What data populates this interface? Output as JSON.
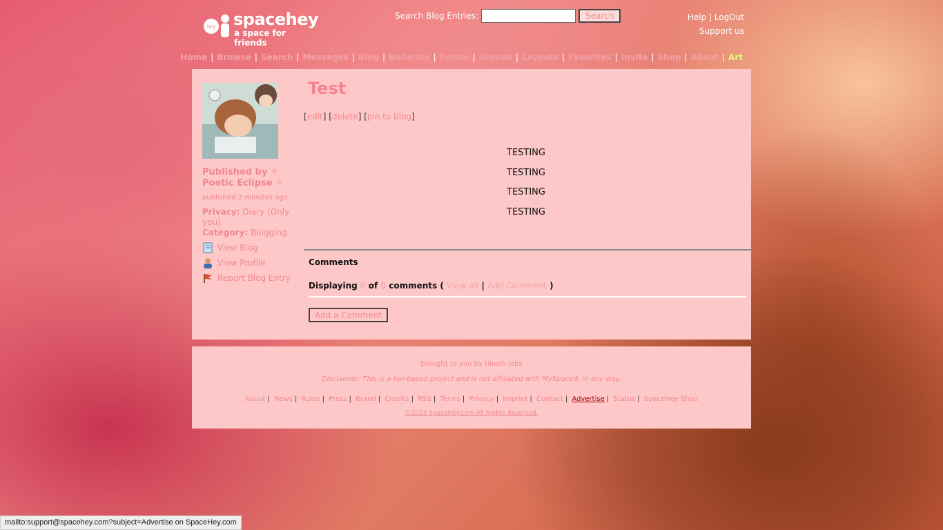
{
  "header": {
    "logo_name": "spacehey",
    "logo_tagline": "a space for friends",
    "search_label": "Search Blog Entries:",
    "search_button": "Search",
    "help": "Help",
    "logout": "LogOut",
    "support": "Support us",
    "nav": [
      "Home",
      "Browse",
      "Search",
      "Messages",
      "Blog",
      "Bulletins",
      "Forum",
      "Groups",
      "Layouts",
      "Favorites",
      "Invite",
      "Shop",
      "About",
      "Art"
    ]
  },
  "post": {
    "title": "Test",
    "actions": {
      "edit": "edit",
      "delete": "delete",
      "pin": "pin to blog"
    },
    "body": [
      "TESTING",
      "TESTING",
      "TESTING",
      "TESTING"
    ],
    "published_by": "Published by ✧ Poetic Eclipse ✧",
    "published_time": "published 2 minutes ago",
    "privacy_label": "Privacy:",
    "privacy_value": "Diary (Only you)",
    "category_label": "Category:",
    "category_value": "Blogging",
    "links": {
      "view_blog": "View Blog",
      "view_profile": "View Profile",
      "report": "Report Blog Entry"
    }
  },
  "comments": {
    "heading": "Comments",
    "displaying": "Displaying",
    "shown": "0",
    "of": "of",
    "total": "0",
    "comments_word": "comments (",
    "view_all": "View all",
    "sep": "|",
    "add_comment_link": "Add Comment",
    "close": ")",
    "add_button": "Add a Comment"
  },
  "footer": {
    "credit": "brought to you by tibush labs",
    "disclaimer": "Disclaimer: This is a fan-based project and is not affiliated with MySpace® in any way.",
    "links": [
      "About",
      "News",
      "Rules",
      "Press",
      "Brand",
      "Credits",
      "RSS",
      "Terms",
      "Privacy",
      "Imprint",
      "Contact",
      "Advertise",
      "Status",
      "SpaceHey Shop"
    ],
    "copyright": "©2023 SpaceHey.com All Rights Reserved."
  },
  "statusbar": "mailto:support@spacehey.com?subject=Advertise on SpaceHey.com"
}
